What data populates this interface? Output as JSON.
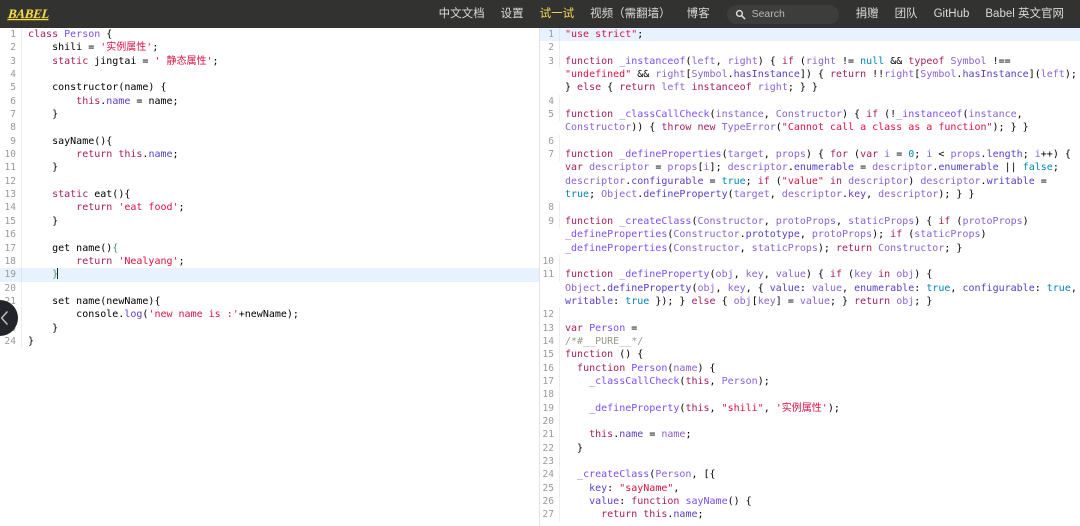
{
  "header": {
    "brand": "BABEL",
    "nav_center": [
      {
        "label": "中文文档",
        "active": false
      },
      {
        "label": "设置",
        "active": false
      },
      {
        "label": "试一试",
        "active": true
      },
      {
        "label": "视频（需翻墙）",
        "active": false
      },
      {
        "label": "博客",
        "active": false
      }
    ],
    "search": {
      "placeholder": "Search",
      "icon": "search-icon"
    },
    "nav_right": [
      {
        "label": "捐赠"
      },
      {
        "label": "团队"
      },
      {
        "label": "GitHub"
      },
      {
        "label": "Babel 英文官网"
      }
    ],
    "colors": {
      "background": "#323330",
      "accent": "#f5da55",
      "link": "#d9d9d9"
    }
  },
  "editor": {
    "collapse_handle_icon": "chevron-left-icon",
    "highlight_color": "#e8f2fe",
    "input": {
      "title": "input-code",
      "lines": [
        {
          "n": 1,
          "html": "<span class=\"kw\">class</span> <span class=\"def\">Person</span> {"
        },
        {
          "n": 2,
          "html": "    shili = <span class=\"str\">'实例属性'</span>;"
        },
        {
          "n": 3,
          "html": "    <span class=\"kw\">static</span> jingtai = <span class=\"str\">' 静态属性'</span>;"
        },
        {
          "n": 4,
          "html": ""
        },
        {
          "n": 5,
          "html": "    constructor(name) {"
        },
        {
          "n": 6,
          "html": "        <span class=\"kw\">this</span>.<span class=\"prop\">name</span> = name;"
        },
        {
          "n": 7,
          "html": "    }"
        },
        {
          "n": 8,
          "html": ""
        },
        {
          "n": 9,
          "html": "    sayName(){"
        },
        {
          "n": 10,
          "html": "        <span class=\"kw\">return</span> <span class=\"kw\">this</span>.<span class=\"prop\">name</span>;"
        },
        {
          "n": 11,
          "html": "    }"
        },
        {
          "n": 12,
          "html": ""
        },
        {
          "n": 13,
          "html": "    <span class=\"kw\">static</span> eat(){"
        },
        {
          "n": 14,
          "html": "        <span class=\"kw\">return</span> <span class=\"str\">'eat food'</span>;"
        },
        {
          "n": 15,
          "html": "    }"
        },
        {
          "n": 16,
          "html": ""
        },
        {
          "n": 17,
          "html": "    get name()<span class=\"brk\">{</span>"
        },
        {
          "n": 18,
          "html": "        <span class=\"kw\">return</span> <span class=\"str\">'Nealyang'</span>;"
        },
        {
          "n": 19,
          "html": "    <span class=\"brk\">}</span><span class=\"caret\"></span>",
          "highlight": true
        },
        {
          "n": 20,
          "html": ""
        },
        {
          "n": 21,
          "html": "    set name(newName){"
        },
        {
          "n": 22,
          "html": "        console.<span class=\"prop\">log</span>(<span class=\"str\">'new name is :'</span>+newName);"
        },
        {
          "n": 23,
          "html": "    }"
        },
        {
          "n": 24,
          "html": "}"
        }
      ]
    },
    "output": {
      "title": "output-code",
      "lines": [
        {
          "n": 1,
          "html": "<span class=\"str\">\"use strict\"</span>;",
          "highlight": true
        },
        {
          "n": 2,
          "html": ""
        },
        {
          "n": 3,
          "html": "<span class=\"kw\">function</span> <span class=\"def\">_instanceof</span>(<span class=\"var\">left</span>, <span class=\"var\">right</span>) { <span class=\"kw\">if</span> (<span class=\"var\">right</span> != <span class=\"atom\">null</span> &amp;&amp; <span class=\"kw\">typeof</span> <span class=\"var\">Symbol</span> !== <span class=\"str\">\"undefined\"</span> &amp;&amp; <span class=\"var\">right</span>[<span class=\"var\">Symbol</span>.<span class=\"prop\">hasInstance</span>]) { <span class=\"kw\">return</span> !!<span class=\"var\">right</span>[<span class=\"var\">Symbol</span>.<span class=\"prop\">hasInstance</span>](<span class=\"var\">left</span>); } <span class=\"kw\">else</span> { <span class=\"kw\">return</span> <span class=\"var\">left</span> <span class=\"kw\">instanceof</span> <span class=\"var\">right</span>; } }"
        },
        {
          "n": 4,
          "html": ""
        },
        {
          "n": 5,
          "html": "<span class=\"kw\">function</span> <span class=\"def\">_classCallCheck</span>(<span class=\"var\">instance</span>, <span class=\"var\">Constructor</span>) { <span class=\"kw\">if</span> (!<span class=\"def\">_instanceof</span>(<span class=\"var\">instance</span>, <span class=\"var\">Constructor</span>)) { <span class=\"kw\">throw</span> <span class=\"kw\">new</span> <span class=\"var\">TypeError</span>(<span class=\"str\">\"Cannot call a class as a function\"</span>); } }"
        },
        {
          "n": 6,
          "html": ""
        },
        {
          "n": 7,
          "html": "<span class=\"kw\">function</span> <span class=\"def\">_defineProperties</span>(<span class=\"var\">target</span>, <span class=\"var\">props</span>) { <span class=\"kw\">for</span> (<span class=\"kw\">var</span> <span class=\"var\">i</span> = <span class=\"num\">0</span>; <span class=\"var\">i</span> &lt; <span class=\"var\">props</span>.<span class=\"prop\">length</span>; <span class=\"var\">i</span>++) { <span class=\"kw\">var</span> <span class=\"var\">descriptor</span> = <span class=\"var\">props</span>[<span class=\"var\">i</span>]; <span class=\"var\">descriptor</span>.<span class=\"prop\">enumerable</span> = <span class=\"var\">descriptor</span>.<span class=\"prop\">enumerable</span> || <span class=\"atom\">false</span>; <span class=\"var\">descriptor</span>.<span class=\"prop\">configurable</span> = <span class=\"atom\">true</span>; <span class=\"kw\">if</span> (<span class=\"str\">\"value\"</span> <span class=\"kw\">in</span> <span class=\"var\">descriptor</span>) <span class=\"var\">descriptor</span>.<span class=\"prop\">writable</span> = <span class=\"atom\">true</span>; <span class=\"var\">Object</span>.<span class=\"prop\">defineProperty</span>(<span class=\"var\">target</span>, <span class=\"var\">descriptor</span>.<span class=\"prop\">key</span>, <span class=\"var\">descriptor</span>); } }"
        },
        {
          "n": 8,
          "html": ""
        },
        {
          "n": 9,
          "html": "<span class=\"kw\">function</span> <span class=\"def\">_createClass</span>(<span class=\"var\">Constructor</span>, <span class=\"var\">protoProps</span>, <span class=\"var\">staticProps</span>) { <span class=\"kw\">if</span> (<span class=\"var\">protoProps</span>) <span class=\"def\">_defineProperties</span>(<span class=\"var\">Constructor</span>.<span class=\"prop\">prototype</span>, <span class=\"var\">protoProps</span>); <span class=\"kw\">if</span> (<span class=\"var\">staticProps</span>) <span class=\"def\">_defineProperties</span>(<span class=\"var\">Constructor</span>, <span class=\"var\">staticProps</span>); <span class=\"kw\">return</span> <span class=\"var\">Constructor</span>; }"
        },
        {
          "n": 10,
          "html": ""
        },
        {
          "n": 11,
          "html": "<span class=\"kw\">function</span> <span class=\"def\">_defineProperty</span>(<span class=\"var\">obj</span>, <span class=\"var\">key</span>, <span class=\"var\">value</span>) { <span class=\"kw\">if</span> (<span class=\"var\">key</span> <span class=\"kw\">in</span> <span class=\"var\">obj</span>) { <span class=\"var\">Object</span>.<span class=\"prop\">defineProperty</span>(<span class=\"var\">obj</span>, <span class=\"var\">key</span>, { <span class=\"prop\">value</span>: <span class=\"var\">value</span>, <span class=\"prop\">enumerable</span>: <span class=\"atom\">true</span>, <span class=\"prop\">configurable</span>: <span class=\"atom\">true</span>, <span class=\"prop\">writable</span>: <span class=\"atom\">true</span> }); } <span class=\"kw\">else</span> { <span class=\"var\">obj</span>[<span class=\"var\">key</span>] = <span class=\"var\">value</span>; } <span class=\"kw\">return</span> <span class=\"var\">obj</span>; }"
        },
        {
          "n": 12,
          "html": ""
        },
        {
          "n": 13,
          "html": "<span class=\"kw\">var</span> <span class=\"def\">Person</span> ="
        },
        {
          "n": 14,
          "html": "<span class=\"cm\">/*#__PURE__*/</span>"
        },
        {
          "n": 15,
          "html": "<span class=\"kw\">function</span> () {"
        },
        {
          "n": 16,
          "html": "  <span class=\"kw\">function</span> <span class=\"def\">Person</span>(<span class=\"var\">name</span>) {"
        },
        {
          "n": 17,
          "html": "    <span class=\"def\">_classCallCheck</span>(<span class=\"kw\">this</span>, <span class=\"var\">Person</span>);"
        },
        {
          "n": 18,
          "html": ""
        },
        {
          "n": 19,
          "html": "    <span class=\"def\">_defineProperty</span>(<span class=\"kw\">this</span>, <span class=\"str\">\"shili\"</span>, <span class=\"str\">'实例属性'</span>);"
        },
        {
          "n": 20,
          "html": ""
        },
        {
          "n": 21,
          "html": "    <span class=\"kw\">this</span>.<span class=\"prop\">name</span> = <span class=\"var\">name</span>;"
        },
        {
          "n": 22,
          "html": "  }"
        },
        {
          "n": 23,
          "html": ""
        },
        {
          "n": 24,
          "html": "  <span class=\"def\">_createClass</span>(<span class=\"var\">Person</span>, [{"
        },
        {
          "n": 25,
          "html": "    <span class=\"prop\">key</span>: <span class=\"str\">\"sayName\"</span>,"
        },
        {
          "n": 26,
          "html": "    <span class=\"prop\">value</span>: <span class=\"kw\">function</span> <span class=\"def\">sayName</span>() {"
        },
        {
          "n": 27,
          "html": "      <span class=\"kw\">return</span> <span class=\"kw\">this</span>.<span class=\"prop\">name</span>;"
        }
      ]
    }
  }
}
